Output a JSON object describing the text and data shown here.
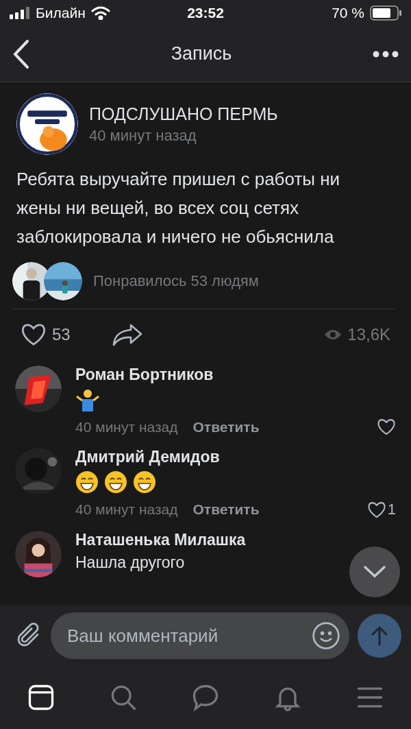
{
  "status_bar": {
    "carrier": "Билайн",
    "time": "23:52",
    "battery": "70 %"
  },
  "nav": {
    "title": "Запись"
  },
  "post": {
    "author": "ПОДСЛУШАНО ПЕРМЬ",
    "time": "40 минут назад",
    "text": "Ребята выручайте пришел с работы ни жены ни вещей, во всех соц сетях заблокировала и ничего не обьяснила",
    "liked_by": "Понравилось 53 людям",
    "likes": "53",
    "views": "13,6K"
  },
  "comments": [
    {
      "author": "Роман Бортников",
      "reactions": [
        {
          "kind": "shrug"
        }
      ],
      "time": "40 минут назад",
      "reply": "Ответить"
    },
    {
      "author": "Дмитрий Демидов",
      "reactions": [
        {
          "kind": "grin"
        },
        {
          "kind": "grin"
        },
        {
          "kind": "grin"
        }
      ],
      "time": "40 минут назад",
      "reply": "Ответить",
      "likes": "1"
    },
    {
      "author": "Наташенька Милашка",
      "text": "Нашла другого"
    }
  ],
  "composer": {
    "placeholder": "Ваш комментарий"
  },
  "tab_bar": [
    {
      "kind": "feed",
      "selected": true
    },
    {
      "kind": "search",
      "selected": false
    },
    {
      "kind": "messages",
      "selected": false
    },
    {
      "kind": "notifications",
      "selected": false
    },
    {
      "kind": "menu",
      "selected": false
    }
  ]
}
